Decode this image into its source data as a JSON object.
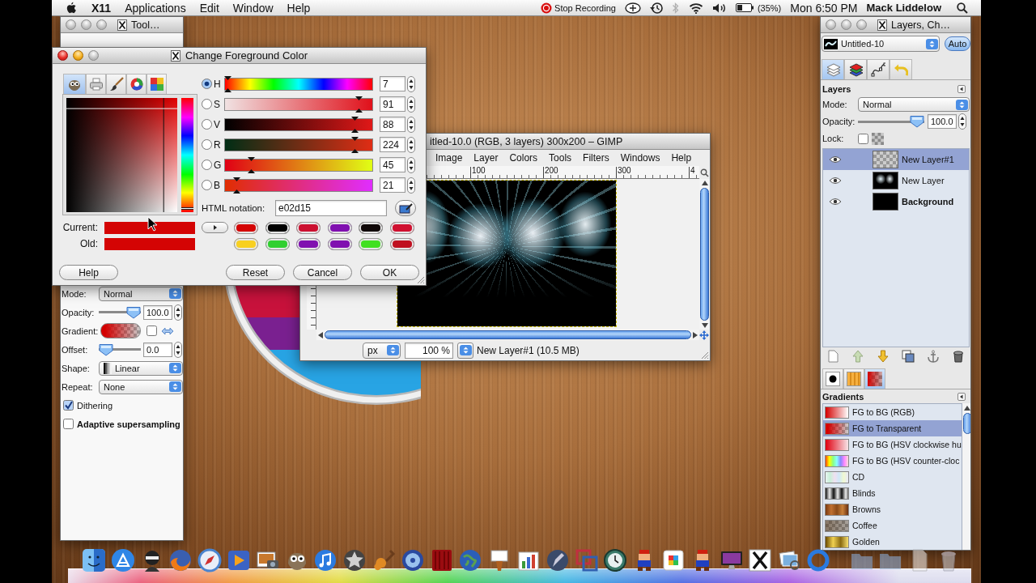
{
  "menu_bar": {
    "app": "X11",
    "menus": [
      "Applications",
      "Edit",
      "Window",
      "Help"
    ],
    "recording": "Stop Recording",
    "battery": "(35%)",
    "clock": "Mon 6:50 PM",
    "user": "Mack Liddelow"
  },
  "toolbox": {
    "title": "Tool…",
    "options": [
      {
        "kind": "dropdown",
        "label": "Mode:",
        "value": "Normal"
      },
      {
        "kind": "slider",
        "label": "Opacity:",
        "value": "100.0",
        "level": 1
      },
      {
        "kind": "gradient",
        "label": "Gradient:",
        "checked": false
      },
      {
        "kind": "slider",
        "label": "Offset:",
        "value": "0.0",
        "level": 0
      },
      {
        "kind": "shape",
        "label": "Shape:",
        "value": "Linear"
      },
      {
        "kind": "dropdown",
        "label": "Repeat:",
        "value": "None"
      },
      {
        "kind": "checkbox",
        "label": "Dithering",
        "checked": true
      },
      {
        "kind": "frame",
        "label": "Adaptive supersampling",
        "checked": false
      }
    ]
  },
  "color_dialog": {
    "title": "Change Foreground Color",
    "tabs": [
      {
        "kind": "mascot",
        "selected": true
      },
      {
        "kind": "printer",
        "selected": false
      },
      {
        "kind": "brush",
        "selected": false
      },
      {
        "kind": "wheel",
        "selected": false
      },
      {
        "kind": "palette",
        "selected": false
      }
    ],
    "channels": [
      {
        "kind": "hue",
        "label": "H",
        "value": "7",
        "level": 0.02,
        "selected": true
      },
      {
        "kind": "saturation",
        "label": "S",
        "value": "91",
        "level": 0.91,
        "selected": false
      },
      {
        "kind": "value",
        "label": "V",
        "value": "88",
        "level": 0.88,
        "selected": false
      },
      {
        "kind": "red",
        "label": "R",
        "value": "224",
        "level": 0.88,
        "selected": false
      },
      {
        "kind": "green",
        "label": "G",
        "value": "45",
        "level": 0.18,
        "selected": false
      },
      {
        "kind": "blue",
        "label": "B",
        "value": "21",
        "level": 0.08,
        "selected": false
      }
    ],
    "html_notation": {
      "label": "HTML notation:",
      "value": "e02d15"
    },
    "swatches": [
      {
        "label": "Current:",
        "color": "#d40404"
      },
      {
        "label": "Old:",
        "color": "#d40404"
      }
    ],
    "history": [
      {
        "color": "#d40404"
      },
      {
        "color": "#000000"
      },
      {
        "color": "#cc1030"
      },
      {
        "color": "#8010b0"
      },
      {
        "color": "#100808"
      },
      {
        "color": "#d01030"
      },
      {
        "color": "#f8d020"
      },
      {
        "color": "#30d030"
      },
      {
        "color": "#8010b0"
      },
      {
        "color": "#8010b0"
      },
      {
        "color": "#40e020"
      },
      {
        "color": "#c01020"
      }
    ],
    "buttons": [
      "Help",
      "Reset",
      "Cancel",
      "OK"
    ]
  },
  "image_window": {
    "title": "itled-10.0 (RGB, 3 layers) 300x200 – GIMP",
    "menus": [
      "Image",
      "Layer",
      "Colors",
      "Tools",
      "Filters",
      "Windows",
      "Help"
    ],
    "ruler_labels": [
      "100",
      "200",
      "300",
      "4"
    ],
    "unit": "px",
    "zoom": "100 %",
    "status": "New Layer#1 (10.5 MB)"
  },
  "layers_dock": {
    "title": "Layers, Ch…",
    "image": "Untitled-10",
    "auto": "Auto",
    "tabs": [
      {
        "kind": "layers",
        "selected": true
      },
      {
        "kind": "channels",
        "selected": false
      },
      {
        "kind": "paths",
        "selected": false
      },
      {
        "kind": "undo",
        "selected": false
      }
    ],
    "layers_panel": {
      "title": "Layers",
      "mode": {
        "label": "Mode:",
        "value": "Normal"
      },
      "opacity": {
        "label": "Opacity:",
        "value": "100.0",
        "level": 1
      },
      "lock": {
        "label": "Lock:",
        "checked": false
      },
      "layers": [
        {
          "name": "New Layer#1",
          "kind": "transparent",
          "visible": true,
          "selected": true,
          "bold": false
        },
        {
          "name": "New Layer",
          "kind": "artwork",
          "visible": true,
          "selected": false,
          "bold": false
        },
        {
          "name": "Background",
          "kind": "black",
          "visible": true,
          "selected": false,
          "bold": true
        }
      ]
    },
    "panel_tabs": [
      {
        "kind": "brushes",
        "selected": false
      },
      {
        "kind": "patterns",
        "selected": false
      },
      {
        "kind": "gradients",
        "selected": true
      }
    ],
    "gradients_panel": {
      "title": "Gradients",
      "items": [
        {
          "name": "FG to BG (RGB)",
          "kind": "fg_bg",
          "selected": false
        },
        {
          "name": "FG to Transparent",
          "kind": "fg_transparent",
          "selected": true
        },
        {
          "name": "FG to BG (HSV clockwise hu",
          "kind": "hsv_cw",
          "selected": false
        },
        {
          "name": "FG to BG (HSV counter-cloc",
          "kind": "hsv_ccw",
          "selected": false
        },
        {
          "name": "CD",
          "kind": "cd",
          "selected": false
        },
        {
          "name": "Blinds",
          "kind": "blinds",
          "selected": false
        },
        {
          "name": "Browns",
          "kind": "browns",
          "selected": false
        },
        {
          "name": "Coffee",
          "kind": "coffee",
          "selected": false
        },
        {
          "name": "Golden",
          "kind": "golden",
          "selected": false
        }
      ]
    }
  }
}
